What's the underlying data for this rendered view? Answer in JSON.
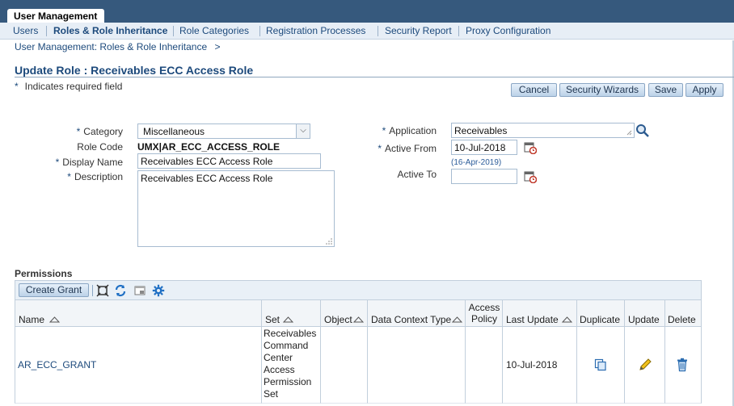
{
  "app_tab": "User Management",
  "nav": {
    "items": [
      "Users",
      "Roles & Role Inheritance",
      "Role Categories",
      "Registration Processes",
      "Security Report",
      "Proxy Configuration"
    ]
  },
  "breadcrumb": {
    "link": "User Management: Roles & Role Inheritance",
    "sep": ">"
  },
  "page": {
    "title": "Update Role : Receivables ECC Access Role",
    "required_star": "*",
    "required_note": "Indicates required field"
  },
  "buttons": {
    "cancel": "Cancel",
    "security_wizards": "Security Wizards",
    "save": "Save",
    "apply": "Apply"
  },
  "form": {
    "category": {
      "label": "Category",
      "value": "Miscellaneous",
      "required": "*"
    },
    "role_code": {
      "label": "Role Code",
      "value": "UMX|AR_ECC_ACCESS_ROLE"
    },
    "display_name": {
      "label": "Display Name",
      "value": "Receivables ECC Access Role",
      "required": "*"
    },
    "description": {
      "label": "Description",
      "value": "Receivables ECC Access Role",
      "required": "*"
    },
    "application": {
      "label": "Application",
      "value": "Receivables",
      "required": "*"
    },
    "active_from": {
      "label": "Active From",
      "value": "10-Jul-2018",
      "hint": "(16-Apr-2019)",
      "required": "*"
    },
    "active_to": {
      "label": "Active To",
      "value": ""
    }
  },
  "permissions": {
    "heading": "Permissions",
    "create_grant": "Create Grant",
    "columns": [
      "Name",
      "Set",
      "Object",
      "Data Context Type",
      "Access Policy",
      "Last Update",
      "Duplicate",
      "Update",
      "Delete"
    ],
    "rows": [
      {
        "name": "AR_ECC_GRANT",
        "set": "Receivables Command Center Access Permission Set",
        "object": "",
        "data_context_type": "",
        "access_policy": "",
        "last_update": "10-Jul-2018"
      }
    ]
  },
  "colors": {
    "brand_band": "#36597d",
    "link": "#1d4a7c",
    "button_gradient_top": "#e6f0fa",
    "button_gradient_bottom": "#bcd2e8"
  },
  "icons": {
    "lookup": "search-icon",
    "calendar": "calendar-icon",
    "detach": "detach-icon",
    "refresh": "refresh-icon",
    "freeze": "freeze-icon",
    "settings": "gear-icon",
    "duplicate": "duplicate-icon",
    "update": "pencil-icon",
    "delete": "trash-icon"
  }
}
